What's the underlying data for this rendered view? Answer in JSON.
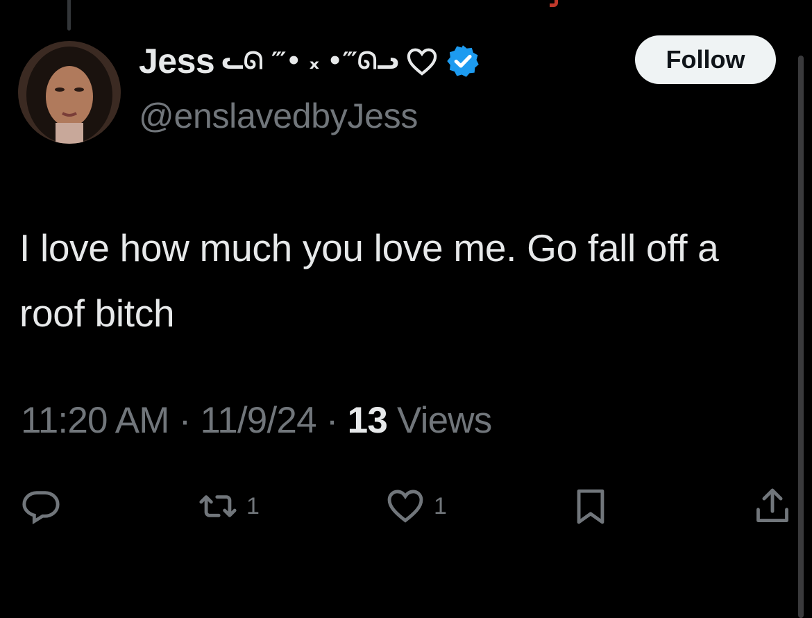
{
  "tweet": {
    "author": {
      "display_name": "Jess",
      "name_decoration": "ᓚᘏ ‴• ₓ •‴ᘏᓗ",
      "handle": "@enslavedbyJess",
      "verified": true
    },
    "follow_label": "Follow",
    "text": "I love how much you love me. Go fall off a roof bitch",
    "time": "11:20 AM",
    "date": "11/9/24",
    "separator": "·",
    "views_count": "13",
    "views_label": "Views",
    "stats": {
      "replies": "",
      "reposts": "1",
      "likes": "1"
    }
  },
  "colors": {
    "background": "#000000",
    "text_primary": "#e7e9ea",
    "text_secondary": "#71767b",
    "verified_blue": "#1d9bf0",
    "follow_bg": "#eff3f4"
  },
  "icons": {
    "reply": "reply-icon",
    "repost": "repost-icon",
    "like": "heart-icon",
    "bookmark": "bookmark-icon",
    "share": "share-icon",
    "verified": "verified-badge-icon"
  }
}
